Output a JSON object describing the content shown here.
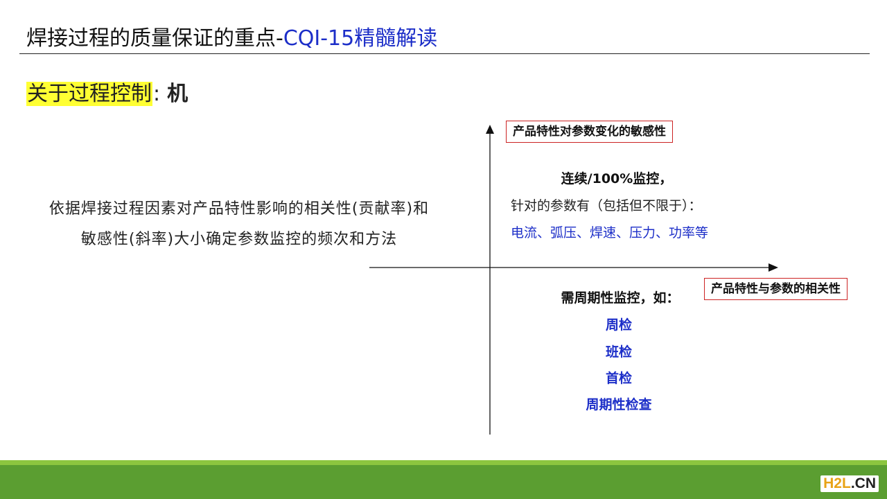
{
  "title": {
    "main": "焊接过程的质量保证的重点-",
    "accent": "CQI-15精髓解读"
  },
  "section": {
    "highlight": "关于过程控制",
    "colon": ":",
    "item": "机"
  },
  "description": [
    "依据焊接过程因素对产品特性影响的相关性(贡献率)和",
    "敏感性(斜率)大小确定参数监控的频次和方法"
  ],
  "axes": {
    "y_label": "产品特性对参数变化的敏感性",
    "x_label": "产品特性与参数的相关性"
  },
  "upper_quadrant": {
    "title": "连续/100%监控，",
    "line": "针对的参数有（包括但不限于）：",
    "params": "电流、弧压、焊速、压力、功率等"
  },
  "lower_quadrant": {
    "title": "需周期性监控，如：",
    "items": [
      "周检",
      "班检",
      "首检",
      "周期性检查"
    ]
  },
  "logo": {
    "part1": "H2L",
    "part2": ".CN"
  },
  "colors": {
    "accent": "#1c2ec8",
    "highlight": "#ffff33",
    "footer": "#5b9e31",
    "footer_light": "#8cc63f",
    "box_border": "#cc2222"
  }
}
